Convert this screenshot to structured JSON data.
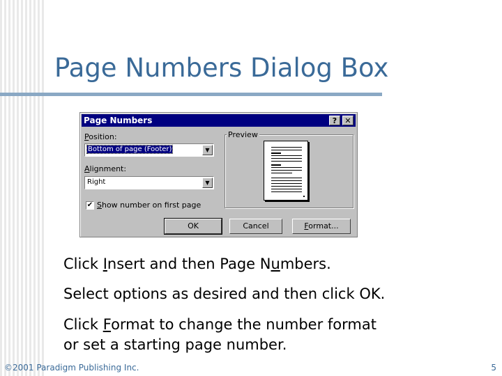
{
  "slide": {
    "title": "Page Numbers Dialog Box",
    "footer_left": "©2001 Paradigm Publishing Inc.",
    "footer_right": "5"
  },
  "dialog": {
    "title": "Page Numbers",
    "help_btn": "?",
    "close_btn": "✕",
    "position": {
      "label_pre": "",
      "label_ul": "P",
      "label_post": "osition:",
      "value": "Bottom of page (Footer)"
    },
    "alignment": {
      "label_pre": "",
      "label_ul": "A",
      "label_post": "lignment:",
      "value": "Right"
    },
    "show_first": {
      "label_pre": "",
      "label_ul": "S",
      "label_post": "how number on first page",
      "checked": true,
      "check_glyph": "✔"
    },
    "preview_label": "Preview",
    "buttons": {
      "ok": "OK",
      "cancel": "Cancel",
      "format_pre": "",
      "format_ul": "F",
      "format_post": "ormat..."
    }
  },
  "bullets": [
    {
      "pre": "Click ",
      "ul": "I",
      "post": "nsert and then Page N",
      "ul2": "u",
      "post2": "mbers."
    },
    {
      "text": "Select options as desired and then click OK."
    },
    {
      "pre": "Click ",
      "ul": "F",
      "post": "ormat to change the number format"
    },
    {
      "text": "or set a starting page number."
    }
  ]
}
